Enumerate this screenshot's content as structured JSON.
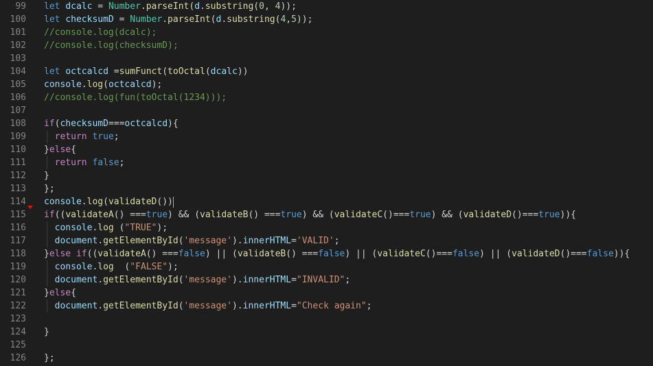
{
  "editor": {
    "language": "javascript",
    "colors": {
      "background": "#1e1e1e",
      "line_number": "#858585",
      "keyword": "#569cd6",
      "control": "#c586c0",
      "variable": "#9cdcfe",
      "function": "#dcdcaa",
      "type": "#4ec9b0",
      "number": "#b5cea8",
      "string": "#ce9178",
      "comment": "#6a9955",
      "text": "#d4d4d4",
      "marker": "#e51400"
    },
    "lines": [
      {
        "n": "99",
        "text": "let dcalc = Number.parseInt(d.substring(0, 4));"
      },
      {
        "n": "100",
        "text": "let checksumD = Number.parseInt(d.substring(4,5));"
      },
      {
        "n": "101",
        "text": "//console.log(dcalc);"
      },
      {
        "n": "102",
        "text": "//console.log(checksumD);"
      },
      {
        "n": "103",
        "text": ""
      },
      {
        "n": "104",
        "text": "let octcalcd =sumFunct(toOctal(dcalc))"
      },
      {
        "n": "105",
        "text": "console.log(octcalcd);"
      },
      {
        "n": "106",
        "text": "//console.log(fun(toOctal(1234)));"
      },
      {
        "n": "107",
        "text": ""
      },
      {
        "n": "108",
        "text": "if(checksumD===octcalcd){"
      },
      {
        "n": "109",
        "text": "  return true;"
      },
      {
        "n": "110",
        "text": "}else{"
      },
      {
        "n": "111",
        "text": "  return false;"
      },
      {
        "n": "112",
        "text": "}"
      },
      {
        "n": "113",
        "text": "};"
      },
      {
        "n": "114",
        "text": "console.log(validateD())"
      },
      {
        "n": "115",
        "text": "if((validateA() ===true) && (validateB() ===true) && (validateC()===true) && (validateD()===true)){"
      },
      {
        "n": "116",
        "text": "  console.log (\"TRUE\");"
      },
      {
        "n": "117",
        "text": "  document.getElementById('message').innerHTML='VALID';"
      },
      {
        "n": "118",
        "text": "}else if((validateA() ===false) || (validateB() ===false) || (validateC()===false) || (validateD()===false)){"
      },
      {
        "n": "119",
        "text": "  console.log  (\"FALSE\");"
      },
      {
        "n": "120",
        "text": "  document.getElementById('message').innerHTML=\"INVALID\";"
      },
      {
        "n": "121",
        "text": "}else{"
      },
      {
        "n": "122",
        "text": "  document.getElementById('message').innerHTML=\"Check again\";"
      },
      {
        "n": "123",
        "text": ""
      },
      {
        "n": "124",
        "text": "}"
      },
      {
        "n": "125",
        "text": ""
      },
      {
        "n": "126",
        "text": "};"
      }
    ]
  }
}
